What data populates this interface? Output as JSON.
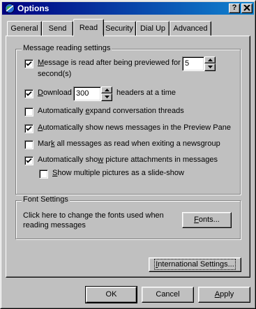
{
  "window": {
    "title": "Options"
  },
  "tabs": [
    "General",
    "Send",
    "Read",
    "Security",
    "Dial Up",
    "Advanced"
  ],
  "message_reading": {
    "group_label": "Message reading settings",
    "previewed": {
      "label_pre": "M",
      "label_post": "essage is read after being previewed for",
      "label_line2": "second(s)",
      "checked": true,
      "value": "5"
    },
    "download": {
      "label_pre": "D",
      "label_post": "ownload",
      "value": "300",
      "suffix": "headers at a time",
      "checked": true
    },
    "expand_threads": {
      "label_pre": "Automatically ",
      "label_ul": "e",
      "label_post": "xpand conversation threads",
      "checked": false
    },
    "preview_pane": {
      "label_pre": "A",
      "label_post": "utomatically show news messages in the Preview Pane",
      "checked": true
    },
    "mark_read": {
      "label_pre": "Mar",
      "label_ul": "k",
      "label_post": " all messages as read when exiting a newsgroup",
      "checked": false
    },
    "show_pictures": {
      "label_pre": "Automatically sho",
      "label_ul": "w",
      "label_post": " picture attachments in messages",
      "checked": true
    },
    "slideshow": {
      "label_pre": "S",
      "label_post": "how multiple pictures as a slide-show",
      "checked": false
    }
  },
  "font_settings": {
    "group_label": "Font Settings",
    "description": "Click here to change the fonts used when reading messages",
    "fonts_button": {
      "label_pre": "F",
      "label_post": "onts..."
    }
  },
  "international_button": {
    "label_pre": "I",
    "label_post": "nternational Settings..."
  },
  "footer": {
    "ok": "OK",
    "cancel": "Cancel",
    "apply": {
      "label_pre": "A",
      "label_post": "pply"
    }
  }
}
